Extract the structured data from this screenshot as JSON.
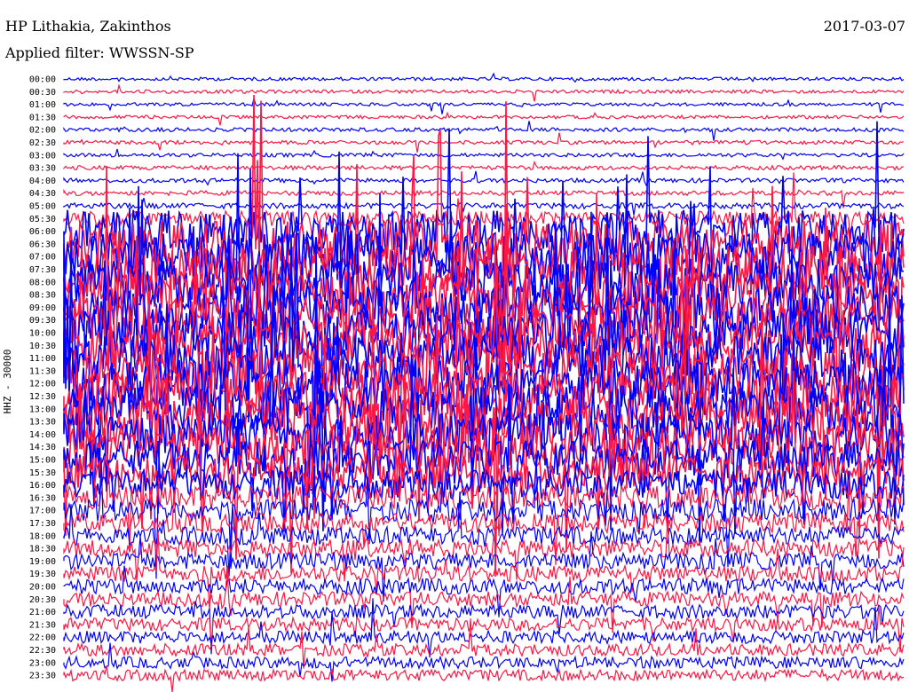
{
  "header": {
    "station": "HP Lithakia, Zakinthos",
    "filter": "Applied filter: WWSSN-SP",
    "date": "2017-03-07"
  },
  "axis": {
    "channel_label": "HHZ - 30000"
  },
  "colors": {
    "trace_a": "#ff1744",
    "trace_b": "#0000ff",
    "background": "#ffffff",
    "text": "#000000"
  },
  "chart_data": {
    "type": "line",
    "title": "HP Lithakia, Zakinthos",
    "subtitle": "Applied filter: WWSSN-SP",
    "date": "2017-03-07",
    "ylabel": "HHZ - 30000",
    "xlabel": "",
    "row_labels": [
      "00:00",
      "00:30",
      "01:00",
      "01:30",
      "02:00",
      "02:30",
      "03:00",
      "03:30",
      "04:00",
      "04:30",
      "05:00",
      "05:30",
      "06:00",
      "06:30",
      "07:00",
      "07:30",
      "08:00",
      "08:30",
      "09:00",
      "09:30",
      "10:00",
      "10:30",
      "11:00",
      "11:30",
      "12:00",
      "12:30",
      "13:00",
      "13:30",
      "14:00",
      "14:30",
      "15:00",
      "15:30",
      "16:00",
      "16:30",
      "17:00",
      "17:30",
      "18:00",
      "18:30",
      "19:00",
      "19:30",
      "20:00",
      "20:30",
      "21:00",
      "21:30",
      "22:00",
      "22:30",
      "23:00",
      "23:30"
    ],
    "row_colors": [
      "trace_b",
      "trace_a"
    ],
    "noise_level_by_row": [
      0.05,
      0.05,
      0.05,
      0.05,
      0.06,
      0.06,
      0.06,
      0.07,
      0.07,
      0.08,
      0.1,
      0.3,
      0.9,
      1.0,
      1.0,
      1.0,
      1.0,
      1.0,
      1.0,
      1.0,
      1.0,
      1.0,
      1.0,
      1.0,
      1.0,
      1.0,
      1.0,
      1.0,
      0.9,
      0.9,
      0.8,
      0.7,
      0.6,
      0.5,
      0.45,
      0.4,
      0.38,
      0.36,
      0.34,
      0.33,
      0.32,
      0.3,
      0.28,
      0.26,
      0.25,
      0.24,
      0.23,
      0.22
    ],
    "grid": false,
    "legend": "none"
  }
}
